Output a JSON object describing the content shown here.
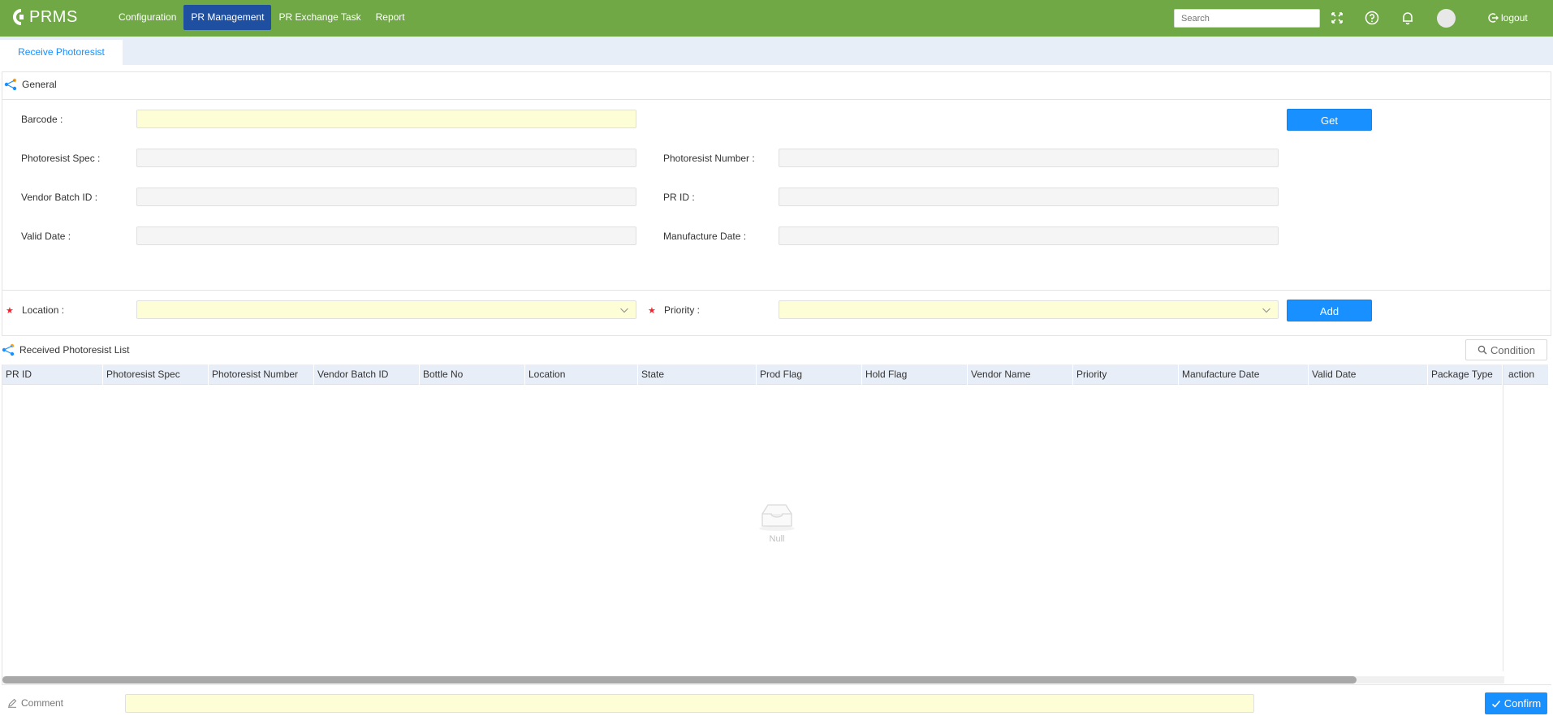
{
  "app": {
    "name": "PRMS"
  },
  "nav": [
    "Configuration",
    "PR Management",
    "PR Exchange Task",
    "Report"
  ],
  "header": {
    "search_placeholder": "Search",
    "logout_label": "logout"
  },
  "tab": {
    "label": "Receive Photoresist"
  },
  "general": {
    "title": "General",
    "barcode_label": "Barcode :",
    "get_label": "Get",
    "spec_label": "Photoresist Spec :",
    "number_label": "Photoresist Number :",
    "vendor_batch_label": "Vendor Batch ID :",
    "prid_label": "PR ID :",
    "valid_date_label": "Valid Date :",
    "manufacture_label": "Manufacture Date :",
    "location_label": "Location :",
    "priority_label": "Priority :",
    "add_label": "Add",
    "required_mark": "★"
  },
  "list": {
    "title": "Received Photoresist List",
    "condition_label": "Condition",
    "columns": [
      "PR ID",
      "Photoresist Spec",
      "Photoresist Number",
      "Vendor Batch ID",
      "Bottle No",
      "Location",
      "State",
      "Prod Flag",
      "Hold Flag",
      "Vendor Name",
      "Priority",
      "Manufacture Date",
      "Valid Date",
      "Package Type"
    ],
    "action_header": "action",
    "empty_text": "Null"
  },
  "footer": {
    "comment_label": "Comment",
    "confirm_label": "Confirm"
  },
  "colors": {
    "topbar": "#6fa844",
    "active_nav": "#1e4fa1",
    "primary": "#1890ff",
    "required": "#f5222d",
    "input_yellow": "#fefed6"
  }
}
